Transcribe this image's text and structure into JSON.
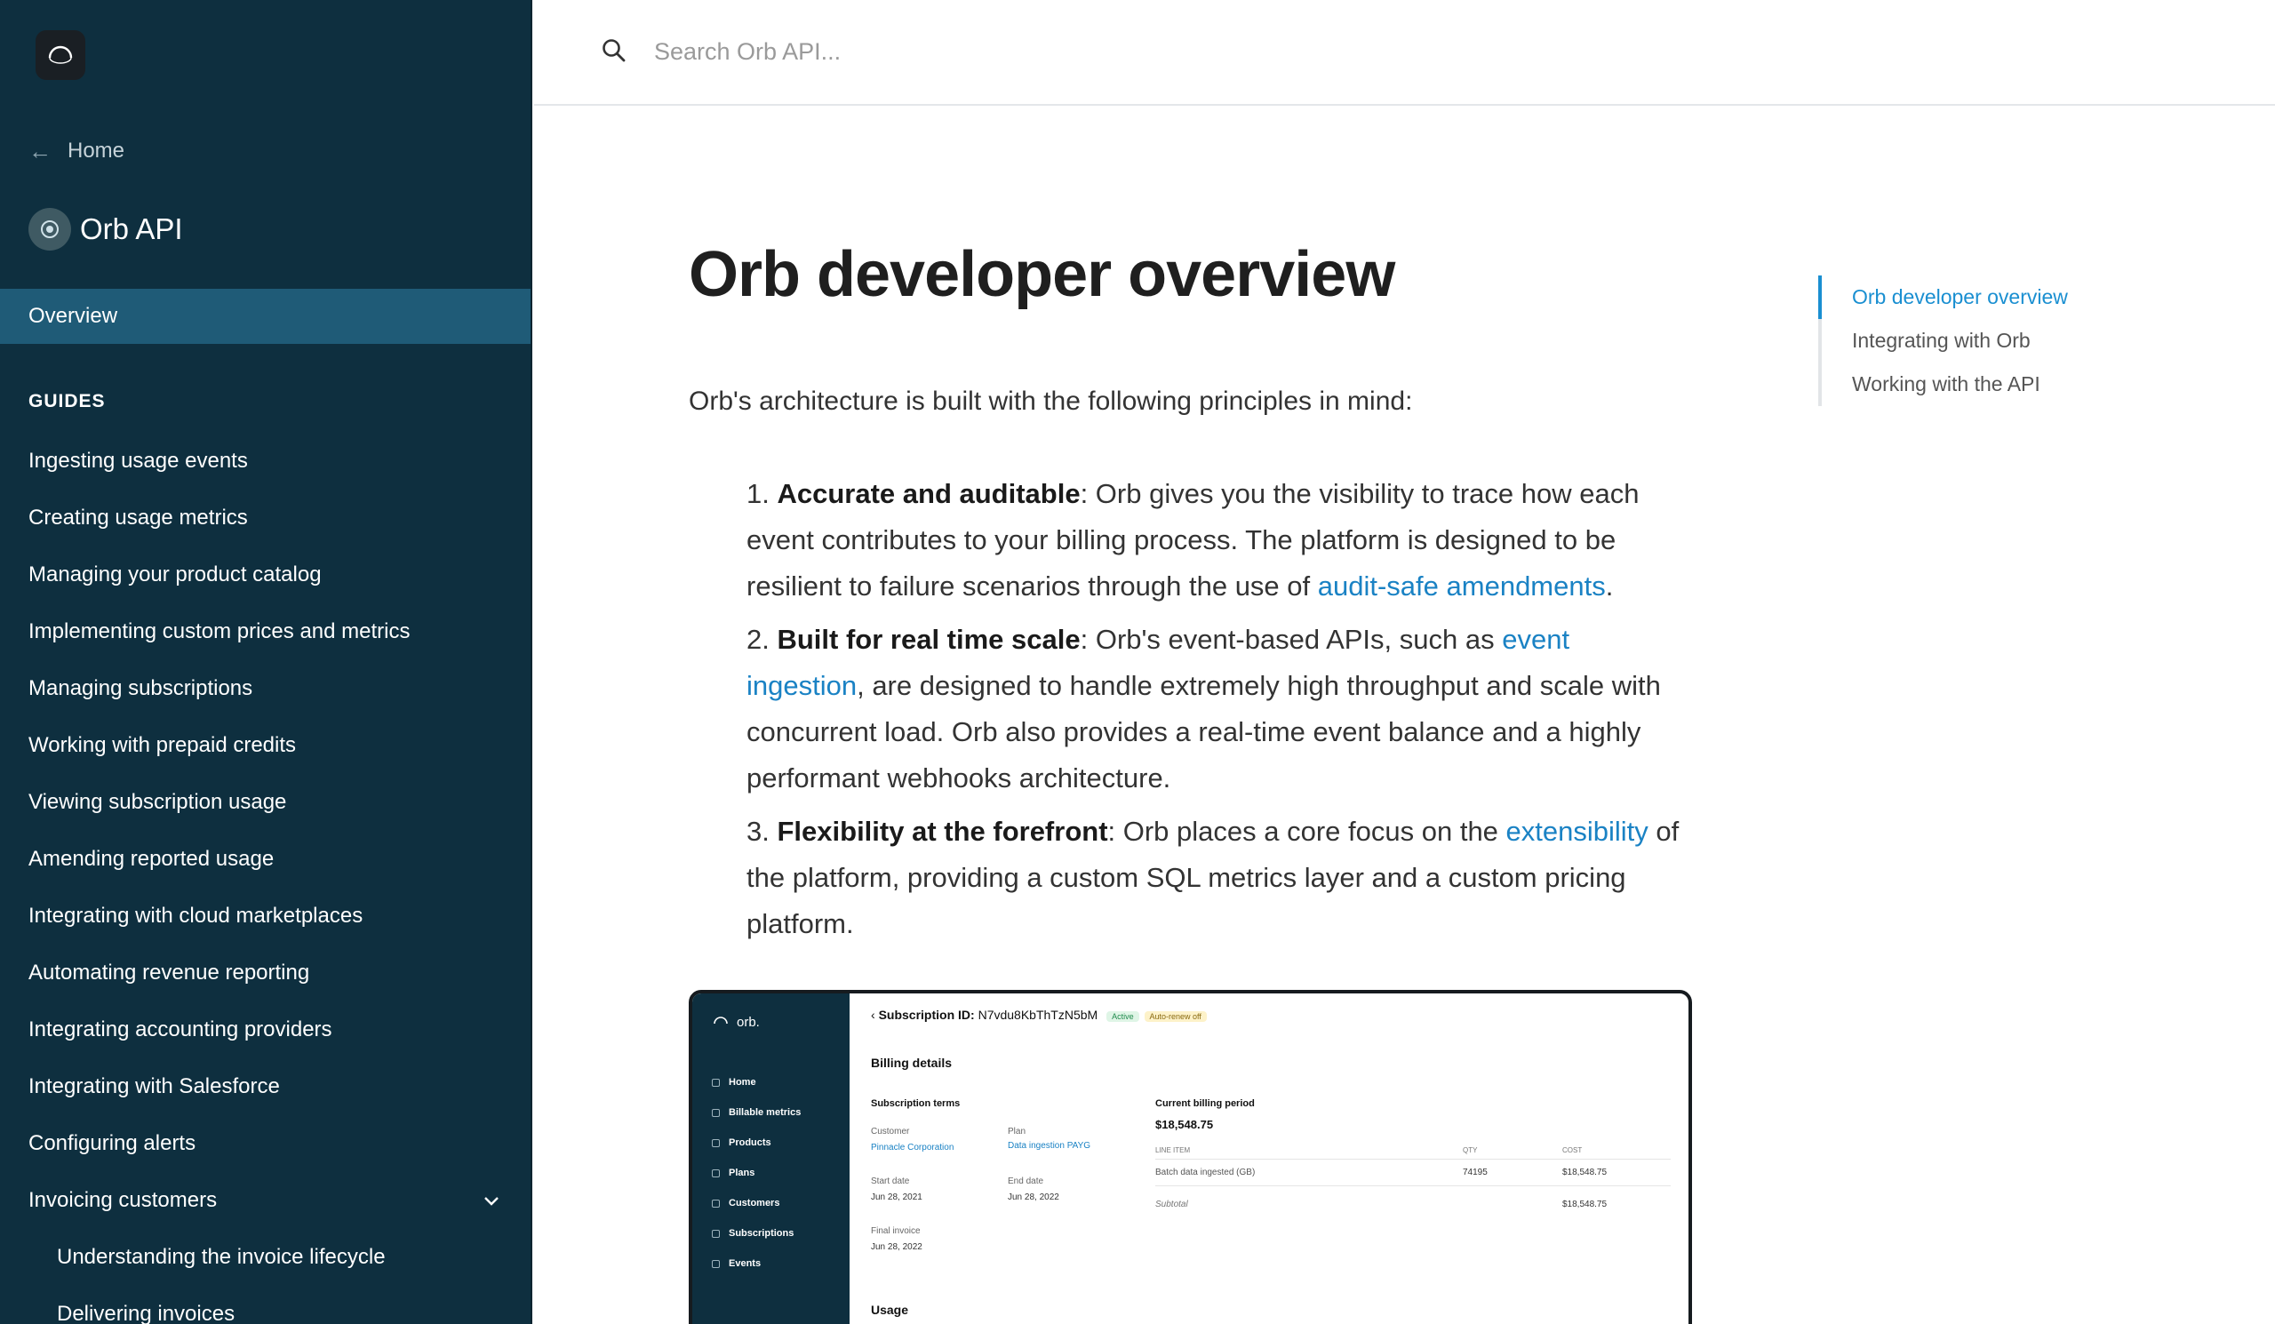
{
  "sidebar": {
    "logo_icon": "orb-logo-icon",
    "home_label": "Home",
    "product_name": "Orb API",
    "overview_label": "Overview",
    "guides_heading": "GUIDES",
    "items": [
      {
        "label": "Ingesting usage events"
      },
      {
        "label": "Creating usage metrics"
      },
      {
        "label": "Managing your product catalog"
      },
      {
        "label": "Implementing custom prices and metrics"
      },
      {
        "label": "Managing subscriptions"
      },
      {
        "label": "Working with prepaid credits"
      },
      {
        "label": "Viewing subscription usage"
      },
      {
        "label": "Amending reported usage"
      },
      {
        "label": "Integrating with cloud marketplaces"
      },
      {
        "label": "Automating revenue reporting"
      },
      {
        "label": "Integrating accounting providers"
      },
      {
        "label": "Integrating with Salesforce"
      },
      {
        "label": "Configuring alerts"
      },
      {
        "label": "Invoicing customers"
      },
      {
        "label": "Understanding the invoice lifecycle"
      },
      {
        "label": "Delivering invoices"
      }
    ]
  },
  "search": {
    "placeholder": "Search Orb API..."
  },
  "page": {
    "title": "Orb developer overview",
    "intro": "Orb's architecture is built with the following principles in mind:",
    "principles": [
      {
        "num": "1.",
        "title": "Accurate and auditable",
        "text_before": ": Orb gives you the visibility to trace how each event contributes to your billing process. The platform is designed to be resilient to failure scenarios through the use of ",
        "link": "audit-safe amendments",
        "text_after": "."
      },
      {
        "num": "2.",
        "title": "Built for real time scale",
        "text_before": ": Orb's event-based APIs, such as ",
        "link": "event ingestion",
        "text_after": ", are designed to handle extremely high throughput and scale with concurrent load. Orb also provides a real-time event balance and a highly performant webhooks architecture."
      },
      {
        "num": "3.",
        "title": "Flexibility at the forefront",
        "text_before": ": Orb places a core focus on the ",
        "link": "extensibility",
        "text_after": " of the platform, providing a custom SQL metrics layer and a custom pricing platform."
      }
    ]
  },
  "toc": {
    "items": [
      {
        "label": "Orb developer overview"
      },
      {
        "label": "Integrating with Orb"
      },
      {
        "label": "Working with the API"
      }
    ]
  },
  "screenshot": {
    "brand": "orb.",
    "nav": [
      "Home",
      "Billable metrics",
      "Products",
      "Plans",
      "Customers",
      "Subscriptions",
      "Events"
    ],
    "sub_id_label": "Subscription ID:",
    "sub_id": "N7vdu8KbThTzN5bM",
    "badge_active": "Active",
    "badge_renew": "Auto-renew off",
    "billing_details": "Billing details",
    "sub_terms": "Subscription terms",
    "customer_label": "Customer",
    "customer": "Pinnacle Corporation",
    "plan_label": "Plan",
    "plan": "Data ingestion PAYG",
    "start_label": "Start date",
    "start": "Jun 28, 2021",
    "end_label": "End date",
    "end": "Jun 28, 2022",
    "final_label": "Final invoice",
    "final": "Jun 28, 2022",
    "period_label": "Current billing period",
    "period_total": "$18,548.75",
    "col_item": "LINE ITEM",
    "col_qty": "QTY",
    "col_cost": "COST",
    "row_item": "Batch data ingested (GB)",
    "row_qty": "74195",
    "row_cost": "$18,548.75",
    "subtotal_label": "Subtotal",
    "subtotal": "$18,548.75",
    "usage": "Usage"
  },
  "colors": {
    "sidebar_bg": "#0e2f3f",
    "active_bg": "#1f5b77",
    "link": "#1a82c4",
    "toc_active": "#1a8fd1"
  }
}
